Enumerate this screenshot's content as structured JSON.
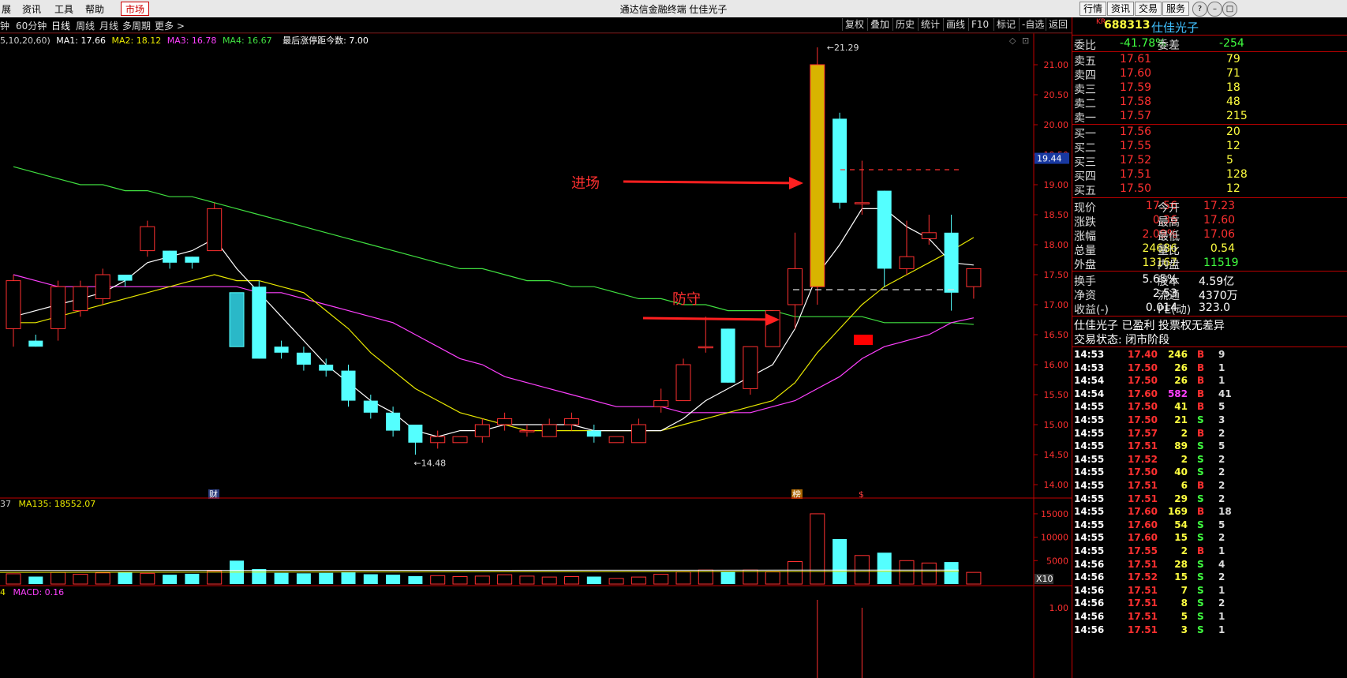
{
  "window": {
    "title": "通达信金融终端  仕佳光子",
    "menu": [
      "展",
      "资讯",
      "工具",
      "帮助",
      "市场"
    ],
    "right_buttons": [
      "行情",
      "资讯",
      "交易",
      "服务"
    ],
    "window_controls": [
      "help-icon",
      "minimize-icon",
      "restore-icon",
      "close-icon"
    ]
  },
  "toolbar": {
    "periods": [
      "钟",
      "60分钟",
      "日线",
      "周线",
      "月线",
      "多周期",
      "更多 >"
    ],
    "active_period": "日线",
    "right_buttons": [
      "复权",
      "叠加",
      "历史",
      "统计",
      "画线",
      "F10",
      "标记",
      "-自选",
      "返回"
    ]
  },
  "ma_legend": {
    "params": "5,10,20,60)",
    "ma1": "MA1: 17.66",
    "ma2": "MA2: 18.12",
    "ma3": "MA3: 16.78",
    "ma4": "MA4: 16.67",
    "note": "最后涨停距今数: 7.00"
  },
  "vol_legend": {
    "prefix": "37",
    "ma135": "MA135: 18552.07"
  },
  "macd_legend": {
    "prefix": "4",
    "macd": "MACD: 0.16"
  },
  "annotations": {
    "entry": "进场",
    "defend": "防守",
    "high_label": "21.29",
    "low_label": "14.48",
    "marker_cai": "财",
    "marker_bang": "榜",
    "marker_s": "$",
    "last_price_tag": "19.44",
    "x10": "X10"
  },
  "colors": {
    "up": "#ff3030",
    "down": "#54ffff",
    "ma1": "#ffffff",
    "ma2": "#e8e800",
    "ma3": "#ff40ff",
    "ma4": "#40e040",
    "axis": "#c00000",
    "label_red": "#ff3030"
  },
  "chart_data": {
    "type": "candlestick",
    "price_axis_ticks": [
      "21.00",
      "20.50",
      "20.00",
      "19.50",
      "19.00",
      "18.50",
      "18.00",
      "17.50",
      "17.00",
      "16.50",
      "16.00",
      "15.50",
      "15.00",
      "14.50",
      "14.00"
    ],
    "volume_axis_ticks": [
      "15000",
      "10000",
      "5000"
    ],
    "macd_axis_ticks": [
      "1.00"
    ],
    "ylim": [
      13.9,
      21.5
    ],
    "candles": [
      [
        16.6,
        17.4,
        16.3,
        17.5
      ],
      [
        16.4,
        16.3,
        16.3,
        16.5
      ],
      [
        16.6,
        17.3,
        16.4,
        17.4
      ],
      [
        16.9,
        17.3,
        16.8,
        17.4
      ],
      [
        17.1,
        17.5,
        17.0,
        17.6
      ],
      [
        17.5,
        17.4,
        17.3,
        17.5
      ],
      [
        17.9,
        18.3,
        17.8,
        18.4
      ],
      [
        17.9,
        17.7,
        17.6,
        17.9
      ],
      [
        17.8,
        17.7,
        17.6,
        17.8
      ],
      [
        17.9,
        18.6,
        17.9,
        18.7
      ],
      [
        17.2,
        16.3,
        16.3,
        17.2
      ],
      [
        17.3,
        16.1,
        16.1,
        17.4
      ],
      [
        16.3,
        16.2,
        16.1,
        16.4
      ],
      [
        16.2,
        16.0,
        15.9,
        16.3
      ],
      [
        16.0,
        15.9,
        15.8,
        16.1
      ],
      [
        15.9,
        15.4,
        15.3,
        16.0
      ],
      [
        15.4,
        15.2,
        15.1,
        15.5
      ],
      [
        15.2,
        14.9,
        14.8,
        15.3
      ],
      [
        15.0,
        14.7,
        14.5,
        15.0
      ],
      [
        14.7,
        14.8,
        14.6,
        14.9
      ],
      [
        14.7,
        14.8,
        14.7,
        14.8
      ],
      [
        14.8,
        15.0,
        14.7,
        15.1
      ],
      [
        15.0,
        15.1,
        14.9,
        15.2
      ],
      [
        14.9,
        14.9,
        14.8,
        15.0
      ],
      [
        14.8,
        15.0,
        14.8,
        15.1
      ],
      [
        15.0,
        15.1,
        14.9,
        15.2
      ],
      [
        14.9,
        14.8,
        14.7,
        15.0
      ],
      [
        14.7,
        14.8,
        14.7,
        14.8
      ],
      [
        14.7,
        15.0,
        14.7,
        15.1
      ],
      [
        15.3,
        15.4,
        15.2,
        15.6
      ],
      [
        15.4,
        16.0,
        15.4,
        16.1
      ],
      [
        16.3,
        16.3,
        16.2,
        16.8
      ],
      [
        16.6,
        15.7,
        15.7,
        16.6
      ],
      [
        15.6,
        16.3,
        15.5,
        16.3
      ],
      [
        16.3,
        16.9,
        16.3,
        16.9
      ],
      [
        17.0,
        17.6,
        16.6,
        18.2
      ],
      [
        17.3,
        21.0,
        17.0,
        21.29
      ],
      [
        20.1,
        18.7,
        18.6,
        20.2
      ],
      [
        18.7,
        18.7,
        18.5,
        19.4
      ],
      [
        18.9,
        17.6,
        17.3,
        18.9
      ],
      [
        17.6,
        17.8,
        17.5,
        18.4
      ],
      [
        18.1,
        18.2,
        18.0,
        18.5
      ],
      [
        18.2,
        17.2,
        16.9,
        18.5
      ],
      [
        17.3,
        17.6,
        17.1,
        17.6
      ]
    ],
    "volumes": [
      2200,
      1600,
      2500,
      2100,
      2400,
      2600,
      2300,
      2000,
      2200,
      2800,
      5000,
      3200,
      2400,
      2300,
      2400,
      2500,
      2100,
      2000,
      1700,
      1800,
      1600,
      1700,
      2000,
      1700,
      1500,
      1600,
      1600,
      1200,
      1500,
      2100,
      2600,
      3000,
      2700,
      3000,
      2600,
      4800,
      15000,
      9600,
      6100,
      6700,
      5000,
      4500,
      4700,
      2500
    ],
    "ma1_line": [
      16.8,
      16.9,
      17.0,
      17.1,
      17.2,
      17.4,
      17.7,
      17.8,
      17.9,
      18.1,
      17.6,
      17.2,
      16.8,
      16.4,
      16.0,
      15.7,
      15.4,
      15.2,
      14.9,
      14.8,
      14.9,
      14.9,
      15.0,
      15.0,
      15.0,
      15.0,
      14.9,
      14.9,
      14.9,
      14.9,
      15.1,
      15.4,
      15.6,
      15.8,
      16.0,
      16.6,
      17.5,
      18.0,
      18.6,
      18.6,
      18.3,
      18.1,
      17.7,
      17.66
    ],
    "ma2_line": [
      16.7,
      16.7,
      16.8,
      16.9,
      17.0,
      17.1,
      17.2,
      17.3,
      17.4,
      17.5,
      17.4,
      17.4,
      17.3,
      17.2,
      16.9,
      16.6,
      16.2,
      15.9,
      15.6,
      15.4,
      15.2,
      15.1,
      15.0,
      14.9,
      14.9,
      14.9,
      14.9,
      14.9,
      14.9,
      14.9,
      15.0,
      15.1,
      15.2,
      15.3,
      15.4,
      15.7,
      16.2,
      16.6,
      17.0,
      17.3,
      17.5,
      17.7,
      17.9,
      18.12
    ],
    "ma3_line": [
      17.5,
      17.4,
      17.3,
      17.3,
      17.3,
      17.3,
      17.3,
      17.3,
      17.3,
      17.3,
      17.3,
      17.2,
      17.2,
      17.1,
      17.0,
      16.9,
      16.8,
      16.7,
      16.5,
      16.3,
      16.1,
      16.0,
      15.8,
      15.7,
      15.6,
      15.5,
      15.4,
      15.3,
      15.3,
      15.3,
      15.2,
      15.2,
      15.2,
      15.2,
      15.3,
      15.4,
      15.6,
      15.8,
      16.1,
      16.3,
      16.4,
      16.5,
      16.7,
      16.78
    ],
    "ma4_line": [
      19.3,
      19.2,
      19.1,
      19.0,
      19.0,
      18.9,
      18.9,
      18.8,
      18.8,
      18.7,
      18.6,
      18.5,
      18.4,
      18.3,
      18.2,
      18.1,
      18.0,
      17.9,
      17.8,
      17.7,
      17.6,
      17.6,
      17.5,
      17.4,
      17.4,
      17.3,
      17.3,
      17.2,
      17.1,
      17.1,
      17.0,
      17.0,
      16.9,
      16.9,
      16.9,
      16.8,
      16.8,
      16.8,
      16.8,
      16.7,
      16.7,
      16.7,
      16.7,
      16.67
    ],
    "entry_level": 19.25,
    "defend_level": 17.25
  },
  "quote": {
    "code": "688313",
    "prefix": "KR",
    "name": "仕佳光子",
    "wei_bi_label": "委比",
    "wei_bi": "-41.78%",
    "wei_cha_label": "委差",
    "wei_cha": "-254",
    "asks": [
      {
        "label": "卖五",
        "price": "17.61",
        "vol": "79"
      },
      {
        "label": "卖四",
        "price": "17.60",
        "vol": "71"
      },
      {
        "label": "卖三",
        "price": "17.59",
        "vol": "18"
      },
      {
        "label": "卖二",
        "price": "17.58",
        "vol": "48"
      },
      {
        "label": "卖一",
        "price": "17.57",
        "vol": "215"
      }
    ],
    "bids": [
      {
        "label": "买一",
        "price": "17.56",
        "vol": "20"
      },
      {
        "label": "买二",
        "price": "17.55",
        "vol": "12"
      },
      {
        "label": "买三",
        "price": "17.52",
        "vol": "5"
      },
      {
        "label": "买四",
        "price": "17.51",
        "vol": "128"
      },
      {
        "label": "买五",
        "price": "17.50",
        "vol": "12"
      }
    ],
    "stats": [
      {
        "l1": "现价",
        "v1": "17.56",
        "l2": "今开",
        "v2": "17.23"
      },
      {
        "l1": "涨跌",
        "v1": "0.36",
        "l2": "最高",
        "v2": "17.60"
      },
      {
        "l1": "涨幅",
        "v1": "2.09%",
        "l2": "最低",
        "v2": "17.06"
      },
      {
        "l1": "总量",
        "v1": "24686",
        "l2": "量比",
        "v2": "0.54"
      },
      {
        "l1": "外盘",
        "v1": "13167",
        "l2": "内盘",
        "v2": "11519"
      }
    ],
    "fin": [
      {
        "l1": "换手",
        "v1": "5.65%",
        "l2": "股本",
        "v2": "4.59亿"
      },
      {
        "l1": "净资",
        "v1": "2.53",
        "l2": "流通",
        "v2": "4370万"
      },
      {
        "l1": "收益(-)",
        "v1": "0.014",
        "l2": "PE(动)",
        "v2": "323.0"
      }
    ],
    "notice": "仕佳光子 已盈利 投票权无差异",
    "status": "交易状态: 闭市阶段",
    "ticks": [
      {
        "t": "14:53",
        "p": "17.40",
        "v": "246",
        "d": "B",
        "n": "9"
      },
      {
        "t": "14:53",
        "p": "17.50",
        "v": "26",
        "d": "B",
        "n": "1"
      },
      {
        "t": "14:54",
        "p": "17.50",
        "v": "26",
        "d": "B",
        "n": "1"
      },
      {
        "t": "14:54",
        "p": "17.60",
        "v": "582",
        "d": "B",
        "n": "41"
      },
      {
        "t": "14:55",
        "p": "17.50",
        "v": "41",
        "d": "B",
        "n": "5"
      },
      {
        "t": "14:55",
        "p": "17.50",
        "v": "21",
        "d": "S",
        "n": "3"
      },
      {
        "t": "14:55",
        "p": "17.57",
        "v": "2",
        "d": "B",
        "n": "2"
      },
      {
        "t": "14:55",
        "p": "17.51",
        "v": "89",
        "d": "S",
        "n": "5"
      },
      {
        "t": "14:55",
        "p": "17.52",
        "v": "2",
        "d": "S",
        "n": "2"
      },
      {
        "t": "14:55",
        "p": "17.50",
        "v": "40",
        "d": "S",
        "n": "2"
      },
      {
        "t": "14:55",
        "p": "17.51",
        "v": "6",
        "d": "B",
        "n": "2"
      },
      {
        "t": "14:55",
        "p": "17.51",
        "v": "29",
        "d": "S",
        "n": "2"
      },
      {
        "t": "14:55",
        "p": "17.60",
        "v": "169",
        "d": "B",
        "n": "18"
      },
      {
        "t": "14:55",
        "p": "17.60",
        "v": "54",
        "d": "S",
        "n": "5"
      },
      {
        "t": "14:55",
        "p": "17.60",
        "v": "15",
        "d": "S",
        "n": "2"
      },
      {
        "t": "14:55",
        "p": "17.55",
        "v": "2",
        "d": "B",
        "n": "1"
      },
      {
        "t": "14:56",
        "p": "17.51",
        "v": "28",
        "d": "S",
        "n": "4"
      },
      {
        "t": "14:56",
        "p": "17.52",
        "v": "15",
        "d": "S",
        "n": "2"
      },
      {
        "t": "14:56",
        "p": "17.51",
        "v": "7",
        "d": "S",
        "n": "1"
      },
      {
        "t": "14:56",
        "p": "17.51",
        "v": "8",
        "d": "S",
        "n": "2"
      },
      {
        "t": "14:56",
        "p": "17.51",
        "v": "5",
        "d": "S",
        "n": "1"
      },
      {
        "t": "14:56",
        "p": "17.51",
        "v": "3",
        "d": "S",
        "n": "1"
      }
    ]
  }
}
